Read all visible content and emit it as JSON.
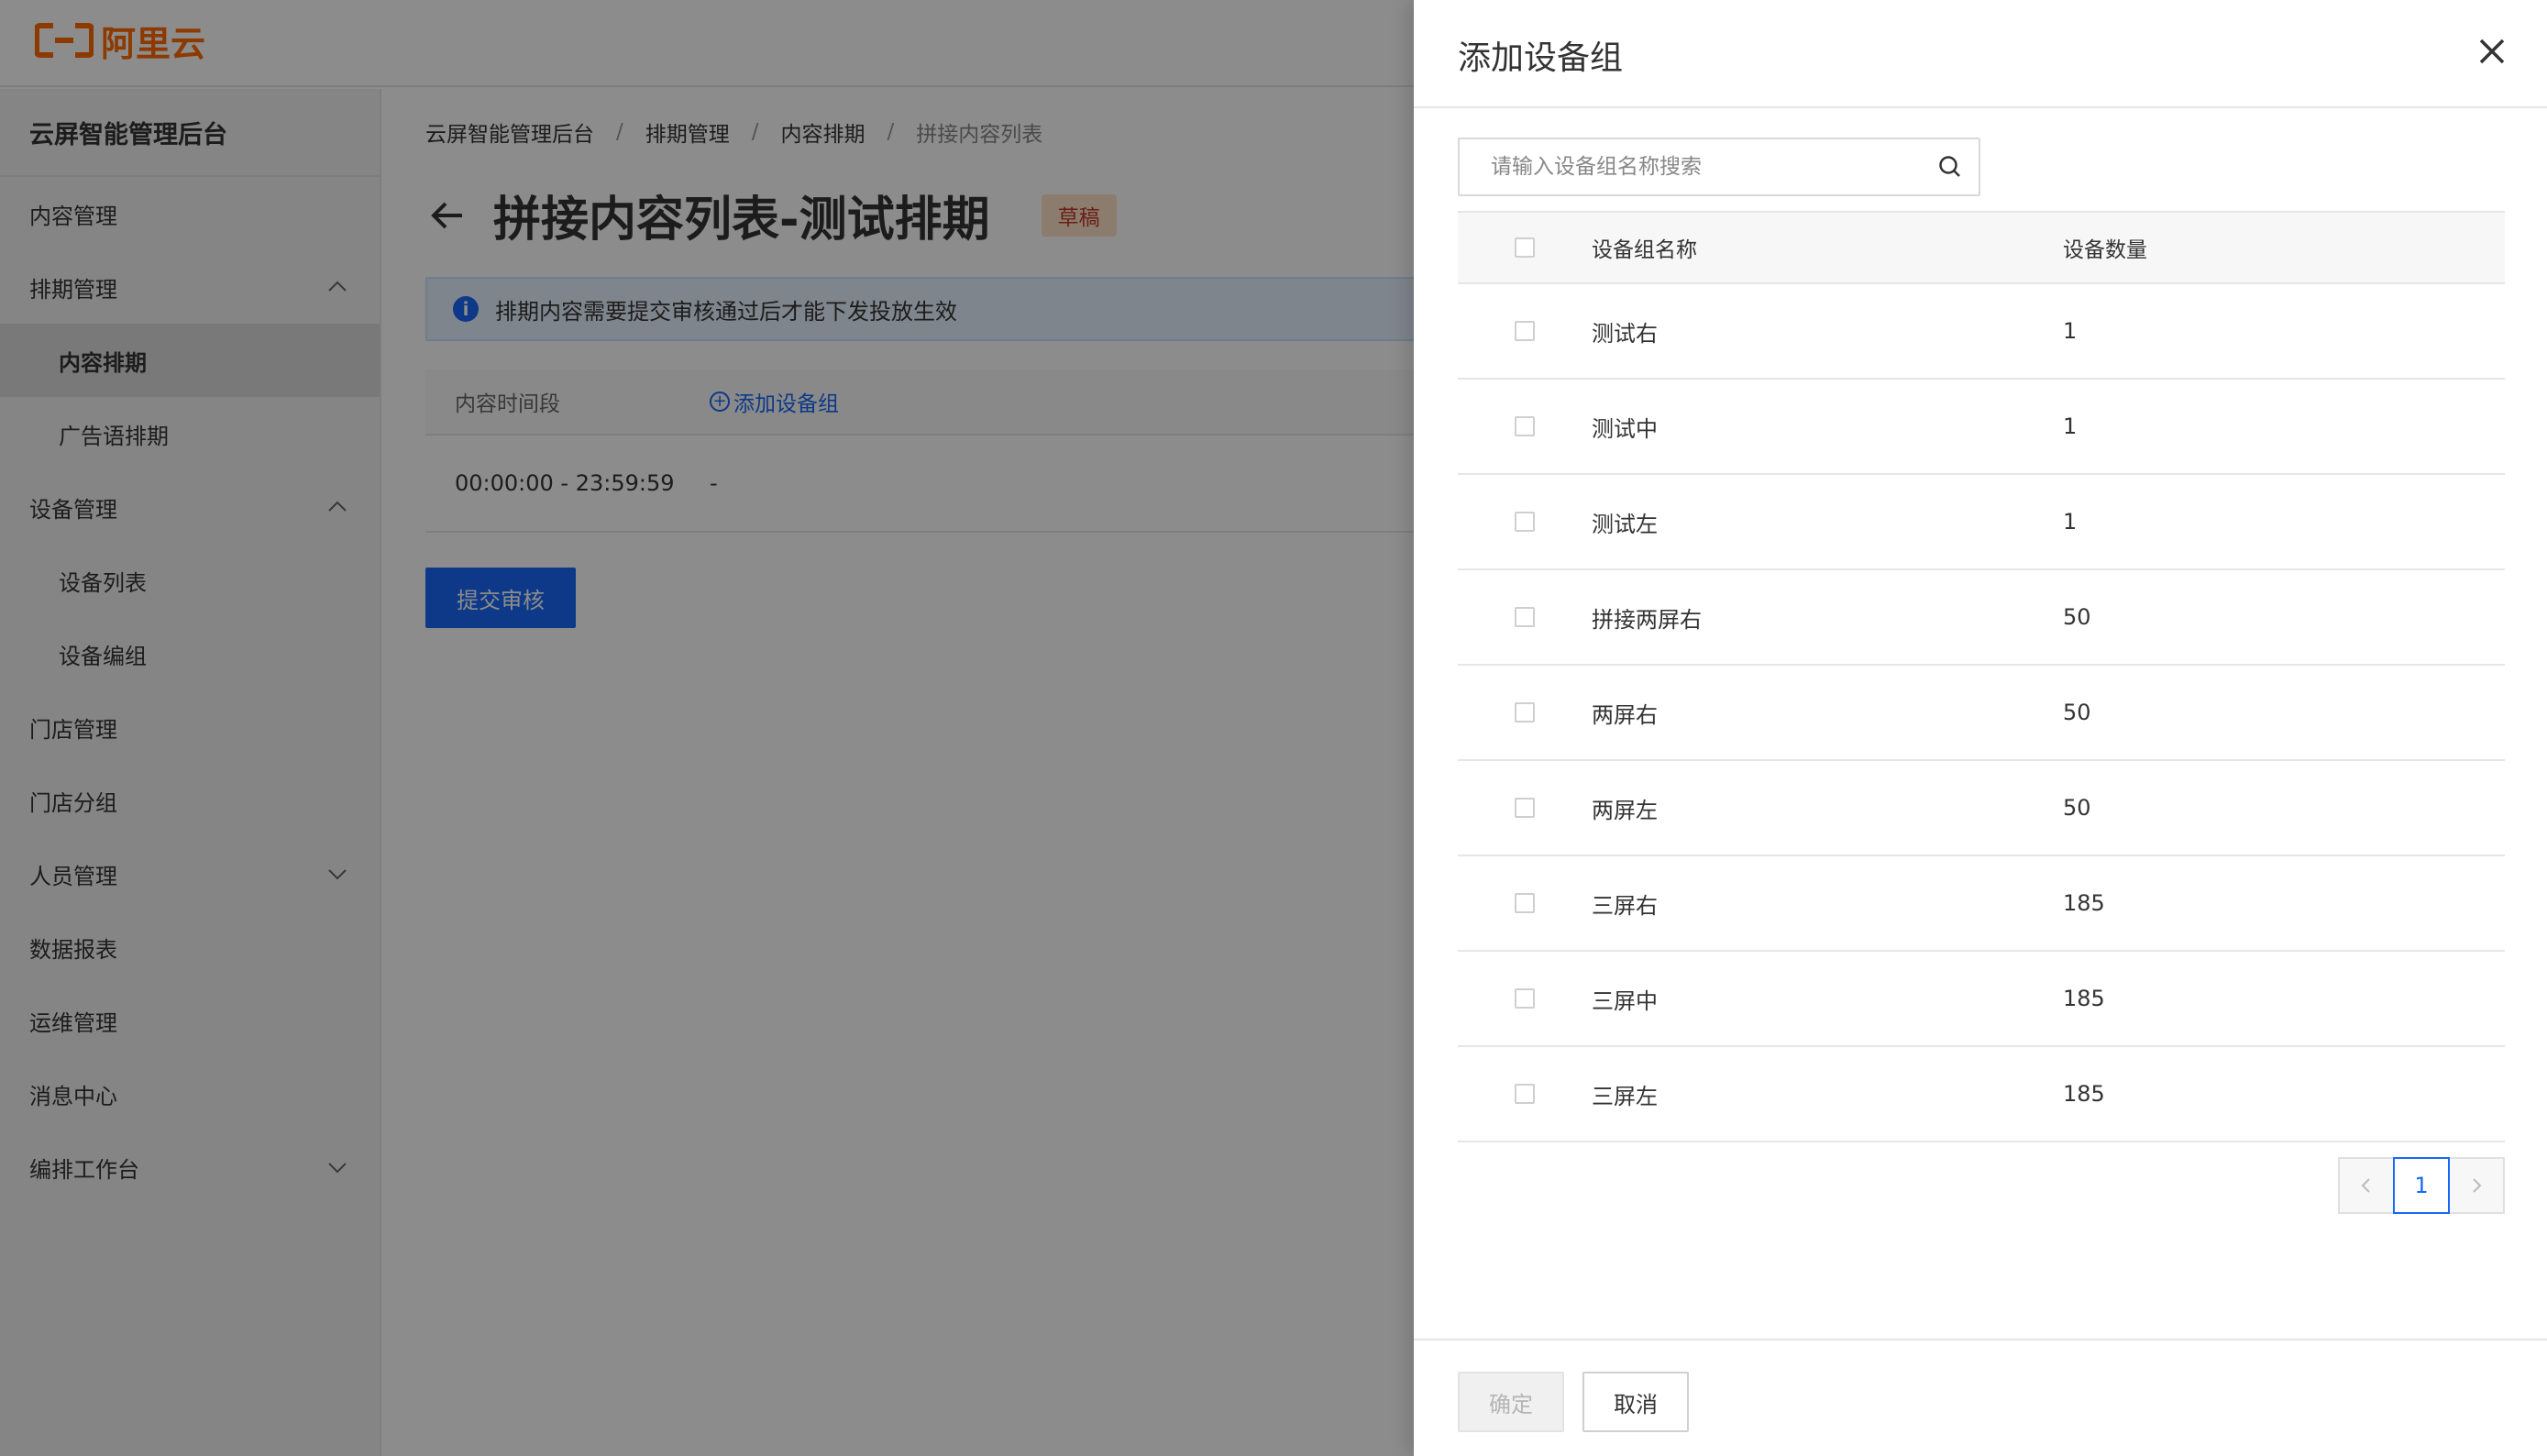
{
  "logo": {
    "text": "阿里云"
  },
  "sidebar": {
    "title": "云屏智能管理后台",
    "items": [
      {
        "label": "内容管理",
        "sub": false,
        "active": false,
        "chevron": ""
      },
      {
        "label": "排期管理",
        "sub": false,
        "active": false,
        "chevron": "up"
      },
      {
        "label": "内容排期",
        "sub": true,
        "active": true,
        "chevron": ""
      },
      {
        "label": "广告语排期",
        "sub": true,
        "active": false,
        "chevron": ""
      },
      {
        "label": "设备管理",
        "sub": false,
        "active": false,
        "chevron": "up"
      },
      {
        "label": "设备列表",
        "sub": true,
        "active": false,
        "chevron": ""
      },
      {
        "label": "设备编组",
        "sub": true,
        "active": false,
        "chevron": ""
      },
      {
        "label": "门店管理",
        "sub": false,
        "active": false,
        "chevron": ""
      },
      {
        "label": "门店分组",
        "sub": false,
        "active": false,
        "chevron": ""
      },
      {
        "label": "人员管理",
        "sub": false,
        "active": false,
        "chevron": "down"
      },
      {
        "label": "数据报表",
        "sub": false,
        "active": false,
        "chevron": ""
      },
      {
        "label": "运维管理",
        "sub": false,
        "active": false,
        "chevron": ""
      },
      {
        "label": "消息中心",
        "sub": false,
        "active": false,
        "chevron": ""
      },
      {
        "label": "编排工作台",
        "sub": false,
        "active": false,
        "chevron": "down"
      }
    ]
  },
  "breadcrumb": [
    "云屏智能管理后台",
    "排期管理",
    "内容排期",
    "拼接内容列表"
  ],
  "page": {
    "title": "拼接内容列表-测试排期",
    "status": "草稿",
    "notice": "排期内容需要提交审核通过后才能下发投放生效",
    "schedule_header": {
      "col1": "内容时间段",
      "add_label": "添加设备组"
    },
    "schedule_row": {
      "time": "00:00:00 - 23:59:59",
      "value": "-"
    },
    "submit_label": "提交审核"
  },
  "drawer": {
    "title": "添加设备组",
    "search_placeholder": "请输入设备组名称搜索",
    "columns": {
      "name": "设备组名称",
      "count": "设备数量"
    },
    "rows": [
      {
        "name": "测试右",
        "count": "1"
      },
      {
        "name": "测试中",
        "count": "1"
      },
      {
        "name": "测试左",
        "count": "1"
      },
      {
        "name": "拼接两屏右",
        "count": "50"
      },
      {
        "name": "两屏右",
        "count": "50"
      },
      {
        "name": "两屏左",
        "count": "50"
      },
      {
        "name": "三屏右",
        "count": "185"
      },
      {
        "name": "三屏中",
        "count": "185"
      },
      {
        "name": "三屏左",
        "count": "185"
      }
    ],
    "pagination": {
      "current": "1"
    },
    "confirm_label": "确定",
    "cancel_label": "取消"
  },
  "colors": {
    "brand": "#ff6a00",
    "primary": "#1868f7",
    "overlay": "rgba(0,0,0,0.45)"
  }
}
